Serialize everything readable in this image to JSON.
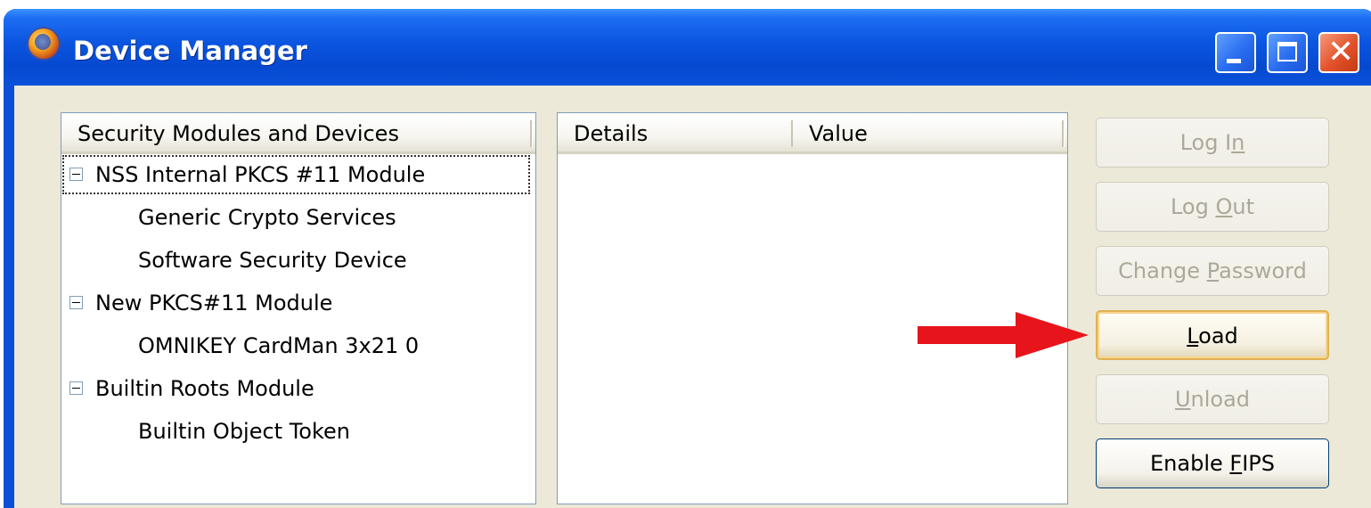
{
  "window": {
    "title": "Device Manager"
  },
  "tree": {
    "header": "Security Modules and Devices",
    "items": [
      {
        "label": "NSS Internal PKCS #11 Module",
        "level": 0,
        "expanded": true,
        "selected": true
      },
      {
        "label": "Generic Crypto Services",
        "level": 1
      },
      {
        "label": "Software Security Device",
        "level": 1
      },
      {
        "label": "New PKCS#11 Module",
        "level": 0,
        "expanded": true
      },
      {
        "label": "OMNIKEY CardMan 3x21 0",
        "level": 1
      },
      {
        "label": "Builtin Roots Module",
        "level": 0,
        "expanded": true
      },
      {
        "label": "Builtin Object Token",
        "level": 1
      }
    ]
  },
  "details": {
    "columns": [
      "Details",
      "Value"
    ]
  },
  "buttons": {
    "login": {
      "pre": "Log I",
      "accel": "n",
      "post": "",
      "enabled": false
    },
    "logout": {
      "pre": "Log ",
      "accel": "O",
      "post": "ut",
      "enabled": false
    },
    "change_password": {
      "pre": "Change ",
      "accel": "P",
      "post": "assword",
      "enabled": false
    },
    "load": {
      "pre": "",
      "accel": "L",
      "post": "oad",
      "enabled": true,
      "focused": true
    },
    "unload": {
      "pre": "",
      "accel": "U",
      "post": "nload",
      "enabled": false
    },
    "enable_fips": {
      "pre": "Enable ",
      "accel": "F",
      "post": "IPS",
      "enabled": true
    }
  },
  "annotation": {
    "arrow_color": "#e8141c",
    "points_to": "load-button"
  },
  "colors": {
    "titlebar": "#0a55e0",
    "dialog_bg": "#ece9d8",
    "disabled_text": "#aca899"
  }
}
